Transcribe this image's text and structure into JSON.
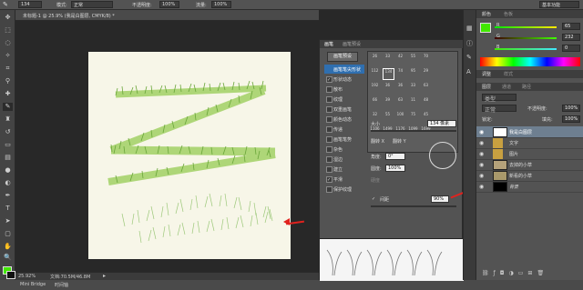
{
  "options_bar": {
    "brush_size": "134",
    "mode_label": "模式:",
    "mode_value": "正常",
    "opacity_label": "不透明度:",
    "opacity_value": "100%",
    "flow_label": "流量:",
    "flow_value": "100%",
    "workspace_label": "基本功能"
  },
  "document": {
    "tab_title": "未标题-1 @ 25.9% (我是白图层, CMYK/8) *",
    "zoom": "25.92%",
    "doc_info": "文档:70.5M/46.8M"
  },
  "bottom_tabs": [
    "Mini Bridge",
    "时间轴"
  ],
  "brush_panel": {
    "tabs": [
      "画笔",
      "画笔预设"
    ],
    "preset_button": "画笔预设",
    "options": [
      {
        "label": "画笔笔尖形状",
        "checked": false,
        "selected": true
      },
      {
        "label": "形状动态",
        "checked": true,
        "selected": false
      },
      {
        "label": "散布",
        "checked": true,
        "selected": false
      },
      {
        "label": "纹理",
        "checked": false,
        "selected": false
      },
      {
        "label": "双重画笔",
        "checked": false,
        "selected": false
      },
      {
        "label": "颜色动态",
        "checked": false,
        "selected": false
      },
      {
        "label": "传递",
        "checked": false,
        "selected": false
      },
      {
        "label": "画笔笔势",
        "checked": false,
        "selected": false
      },
      {
        "label": "杂色",
        "checked": false,
        "selected": false
      },
      {
        "label": "湿边",
        "checked": false,
        "selected": false
      },
      {
        "label": "建立",
        "checked": false,
        "selected": false
      },
      {
        "label": "平滑",
        "checked": true,
        "selected": false
      },
      {
        "label": "保护纹理",
        "checked": false,
        "selected": false
      }
    ],
    "brush_sizes": [
      "26",
      "33",
      "42",
      "55",
      "70",
      "112",
      "134",
      "74",
      "95",
      "29",
      "192",
      "36",
      "36",
      "33",
      "63",
      "66",
      "39",
      "63",
      "11",
      "48",
      "32",
      "55",
      "100",
      "75",
      "45",
      "1106",
      "1499",
      "1176",
      "1099",
      "1699"
    ],
    "size_label": "大小",
    "size_value": "134 像素",
    "flip_x_label": "翻转 X",
    "flip_y_label": "翻转 Y",
    "angle_label": "角度:",
    "angle_value": "0°",
    "roundness_label": "圆度:",
    "roundness_value": "100%",
    "hardness_label": "硬度",
    "spacing_label": "间距",
    "spacing_value": "90%"
  },
  "color_panel": {
    "tabs": [
      "颜色",
      "色板"
    ],
    "r_label": "R",
    "r_value": "65",
    "g_label": "G",
    "g_value": "232",
    "b_label": "B",
    "b_value": "0",
    "swatch_color": "#41e800"
  },
  "adjust_tabs": [
    "调整",
    "样式"
  ],
  "layers_panel": {
    "tabs": [
      "图层",
      "通道",
      "路径"
    ],
    "kind_label": "类型",
    "blend_mode": "正常",
    "opacity_label": "不透明度:",
    "opacity_value": "100%",
    "lock_label": "锁定:",
    "fill_label": "填充:",
    "fill_value": "100%",
    "layers": [
      {
        "name": "我是白图层",
        "selected": true,
        "type": "white"
      },
      {
        "name": "文字",
        "selected": false,
        "type": "group"
      },
      {
        "name": "图片",
        "selected": false,
        "type": "group"
      },
      {
        "name": "去掉的小草",
        "selected": false,
        "type": "image"
      },
      {
        "name": "新看的小草",
        "selected": false,
        "type": "image"
      },
      {
        "name": "背景",
        "selected": false,
        "type": "black"
      }
    ]
  },
  "colors": {
    "accent": "#41e800",
    "arrow": "#e0221e",
    "grass": "#8bc34a"
  }
}
